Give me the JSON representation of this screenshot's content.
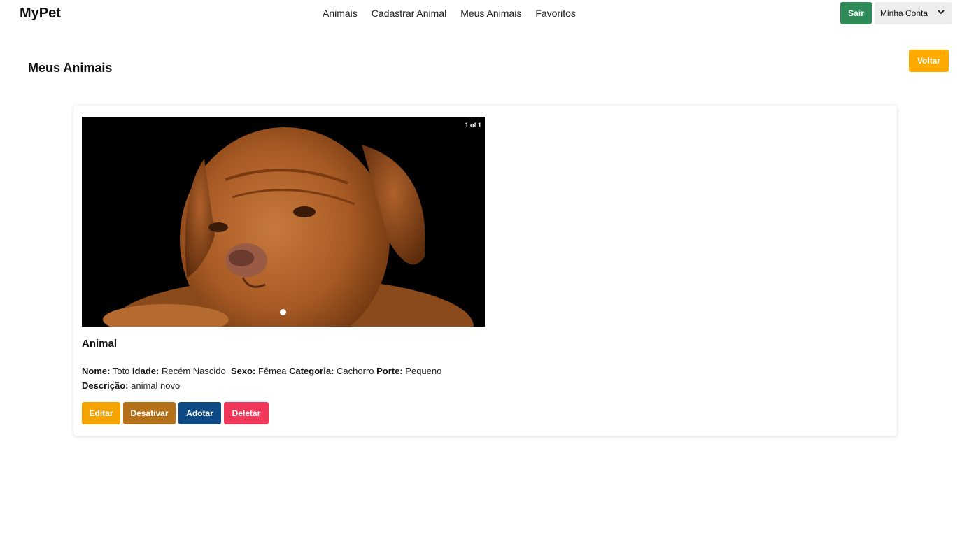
{
  "header": {
    "brand": "MyPet",
    "nav": [
      "Animais",
      "Cadastrar Animal",
      "Meus Animais",
      "Favoritos"
    ],
    "logout_label": "Sair",
    "account_label": "Minha Conta"
  },
  "page": {
    "title": "Meus Animais",
    "back_label": "Voltar"
  },
  "card": {
    "image_counter": "1 of 1",
    "title": "Animal",
    "fields": {
      "nome_label": "Nome:",
      "nome": "Toto",
      "idade_label": "Idade:",
      "idade": "Recém Nascido",
      "sexo_label": "Sexo:",
      "sexo": "Fêmea",
      "categoria_label": "Categoria:",
      "categoria": "Cachorro",
      "porte_label": "Porte:",
      "porte": "Pequeno",
      "descricao_label": "Descrição:",
      "descricao": "animal novo"
    },
    "actions": {
      "edit": "Editar",
      "deactivate": "Desativar",
      "adopt": "Adotar",
      "delete": "Deletar"
    }
  },
  "colors": {
    "logout": "#2e8b57",
    "back": "#ffaa00",
    "edit": "#f5a300",
    "deactivate": "#b5701a",
    "adopt": "#0d4a86",
    "delete": "#f2385a"
  },
  "icons": [
    "chevron-down-icon"
  ]
}
